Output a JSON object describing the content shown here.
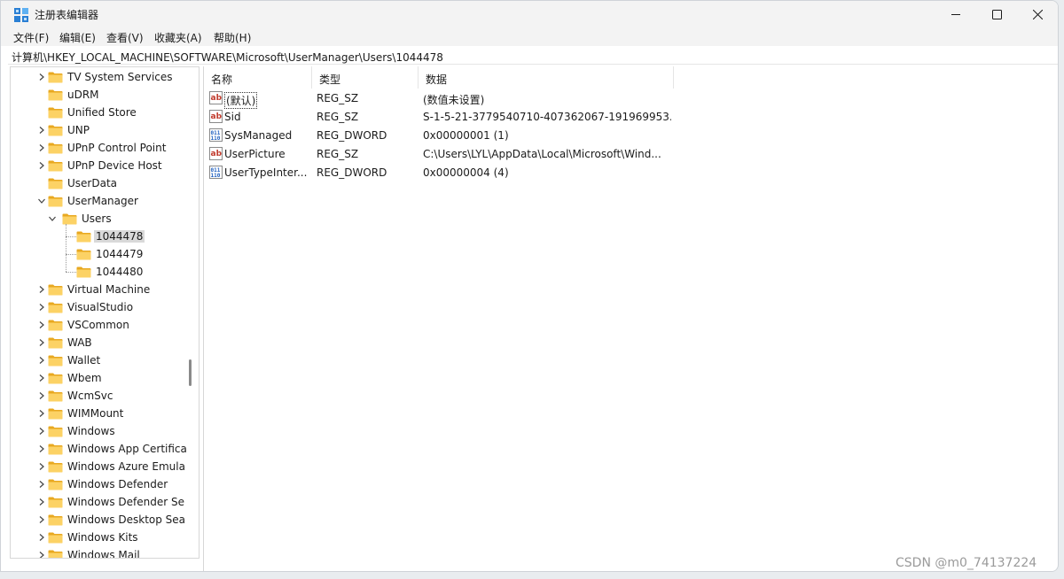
{
  "window": {
    "title": "注册表编辑器"
  },
  "menu": {
    "items": [
      "文件(F)",
      "编辑(E)",
      "查看(V)",
      "收藏夹(A)",
      "帮助(H)"
    ]
  },
  "address": {
    "path": "计算机\\HKEY_LOCAL_MACHINE\\SOFTWARE\\Microsoft\\UserManager\\Users\\1044478"
  },
  "tree": {
    "items": [
      {
        "label": "TV System Services",
        "expandable": true
      },
      {
        "label": "uDRM",
        "expandable": false
      },
      {
        "label": "Unified Store",
        "expandable": false
      },
      {
        "label": "UNP",
        "expandable": true
      },
      {
        "label": "UPnP Control Point",
        "expandable": true
      },
      {
        "label": "UPnP Device Host",
        "expandable": true
      },
      {
        "label": "UserData",
        "expandable": false
      },
      {
        "label": "UserManager",
        "expandable": true,
        "expanded": true
      },
      {
        "label": "Users",
        "expandable": true,
        "expanded": true
      },
      {
        "label": "1044478",
        "selected": true
      },
      {
        "label": "1044479"
      },
      {
        "label": "1044480"
      },
      {
        "label": "Virtual Machine",
        "expandable": true
      },
      {
        "label": "VisualStudio",
        "expandable": true
      },
      {
        "label": "VSCommon",
        "expandable": true
      },
      {
        "label": "WAB",
        "expandable": true
      },
      {
        "label": "Wallet",
        "expandable": true
      },
      {
        "label": "Wbem",
        "expandable": true
      },
      {
        "label": "WcmSvc",
        "expandable": true
      },
      {
        "label": "WIMMount",
        "expandable": true
      },
      {
        "label": "Windows",
        "expandable": true
      },
      {
        "label": "Windows App Certifica",
        "expandable": true
      },
      {
        "label": "Windows Azure Emula",
        "expandable": true
      },
      {
        "label": "Windows Defender",
        "expandable": true
      },
      {
        "label": "Windows Defender Se",
        "expandable": true
      },
      {
        "label": "Windows Desktop Sea",
        "expandable": true
      },
      {
        "label": "Windows Kits",
        "expandable": true
      },
      {
        "label": "Windows Mail",
        "expandable": true
      }
    ]
  },
  "list": {
    "columns": [
      "名称",
      "类型",
      "数据"
    ],
    "rows": [
      {
        "icon": "string-value-icon",
        "name": "(默认)",
        "type": "REG_SZ",
        "data": "(数值未设置)"
      },
      {
        "icon": "string-value-icon",
        "name": "Sid",
        "type": "REG_SZ",
        "data": "S-1-5-21-3779540710-407362067-191969953..."
      },
      {
        "icon": "dword-value-icon",
        "name": "SysManaged",
        "type": "REG_DWORD",
        "data": "0x00000001 (1)"
      },
      {
        "icon": "string-value-icon",
        "name": "UserPicture",
        "type": "REG_SZ",
        "data": "C:\\Users\\LYL\\AppData\\Local\\Microsoft\\Wind..."
      },
      {
        "icon": "dword-value-icon",
        "name": "UserTypeInter...",
        "type": "REG_DWORD",
        "data": "0x00000004 (4)"
      }
    ]
  },
  "watermark": {
    "text": "CSDN @m0_74137224"
  }
}
